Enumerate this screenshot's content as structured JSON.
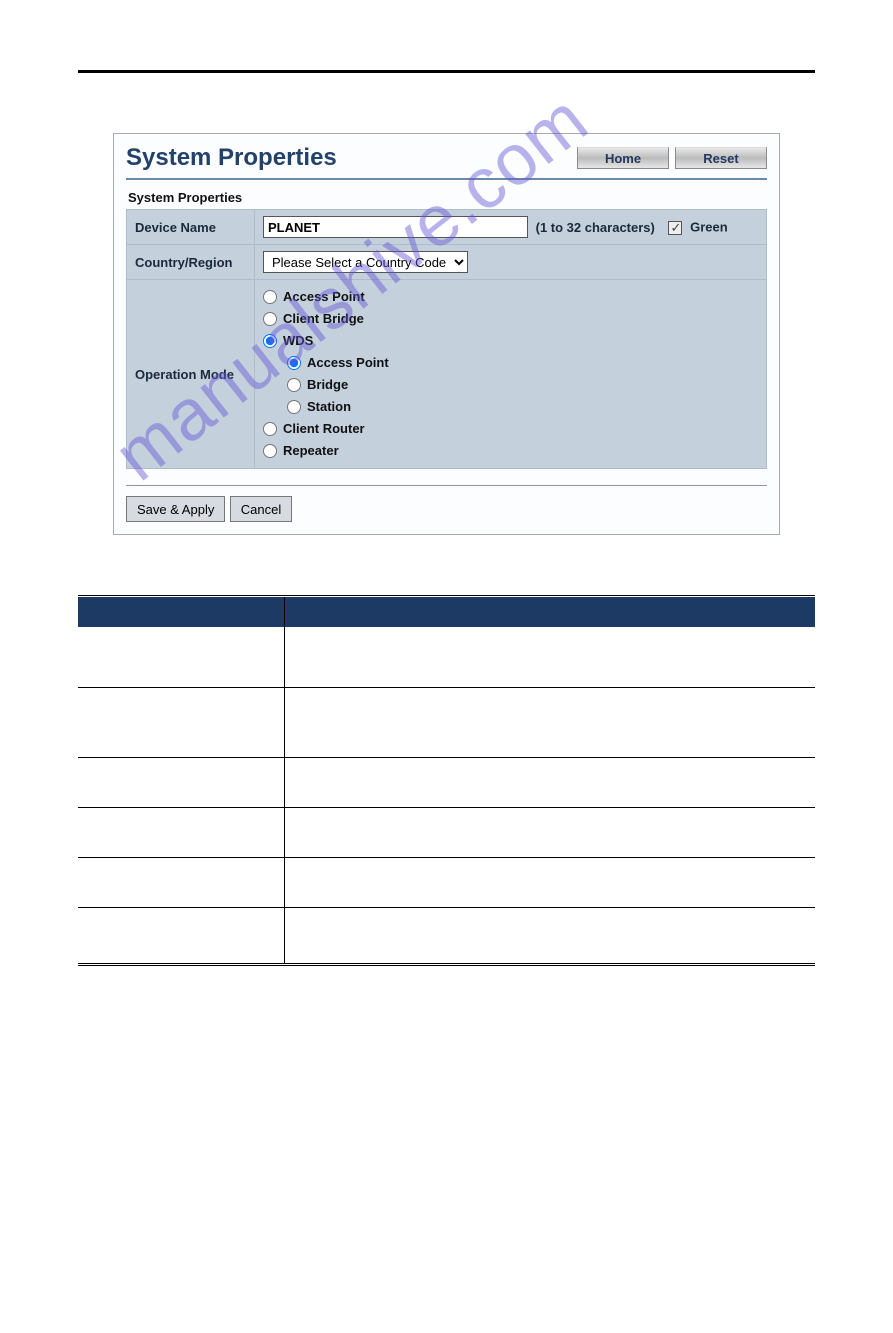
{
  "watermark": "manualshive.com",
  "panel": {
    "title": "System Properties",
    "buttons": {
      "home": "Home",
      "reset": "Reset"
    },
    "section_label": "System Properties",
    "device_name": {
      "label": "Device Name",
      "value": "PLANET",
      "hint": "(1 to 32 characters)",
      "green_label": "Green",
      "green_checked": true
    },
    "country": {
      "label": "Country/Region",
      "selected": "Please Select a Country Code"
    },
    "op_mode": {
      "label": "Operation Mode",
      "options": {
        "ap": "Access Point",
        "cb": "Client Bridge",
        "wds": "WDS",
        "wds_ap": "Access Point",
        "wds_bridge": "Bridge",
        "wds_station": "Station",
        "cr": "Client Router",
        "rep": "Repeater"
      },
      "selected_main": "wds",
      "selected_sub": "wds_ap"
    },
    "footer": {
      "save": "Save & Apply",
      "cancel": "Cancel"
    }
  },
  "desc_table": {
    "rows": [
      {
        "object": "",
        "description": ""
      },
      {
        "object": "",
        "description": ""
      },
      {
        "object": "",
        "description": ""
      },
      {
        "object": "",
        "description": ""
      },
      {
        "object": "",
        "description": ""
      },
      {
        "object": "",
        "description": ""
      }
    ]
  }
}
